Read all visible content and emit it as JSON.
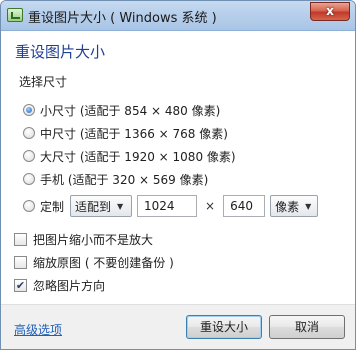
{
  "window": {
    "title": "重设图片大小 ( Windows 系统 )",
    "close_glyph": "x"
  },
  "heading": "重设图片大小",
  "size_section": {
    "label": "选择尺寸",
    "options": [
      {
        "label": "小尺寸 (适配于 854 × 480 像素)",
        "checked": true
      },
      {
        "label": "中尺寸 (适配于 1366 × 768 像素)",
        "checked": false
      },
      {
        "label": "大尺寸 (适配于 1920 × 1080 像素)",
        "checked": false
      },
      {
        "label": "手机 (适配于 320 × 569 像素)",
        "checked": false
      }
    ],
    "custom": {
      "label": "定制",
      "mode": "适配到",
      "width": "1024",
      "times": "×",
      "height": "640",
      "unit": "像素"
    }
  },
  "checkboxes": [
    {
      "label": "把图片缩小而不是放大",
      "checked": false
    },
    {
      "label": "缩放原图 ( 不要创建备份 )",
      "checked": false
    },
    {
      "label": "忽略图片方向",
      "checked": true
    }
  ],
  "footer": {
    "advanced_link": "高级选项",
    "resize_button": "重设大小",
    "cancel_button": "取消"
  },
  "icons": {
    "app": "picture-resize-icon",
    "close": "close-icon",
    "dropdown": "chevron-down-icon",
    "check": "checkmark-icon"
  }
}
